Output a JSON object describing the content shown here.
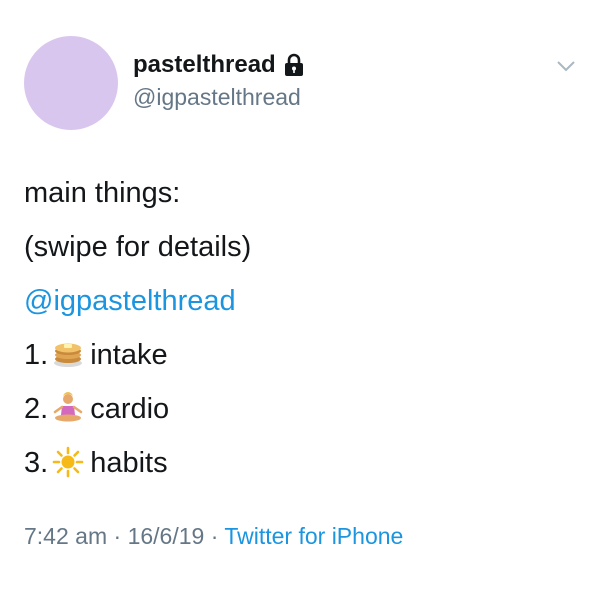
{
  "author": {
    "display_name": "pastelthread",
    "handle": "@igpastelthread",
    "avatar_color": "#d9c6ee",
    "protected_icon": "lock-icon"
  },
  "menu": {
    "icon": "chevron-down-icon"
  },
  "tweet": {
    "line1": "main things:",
    "line2": "(swipe for details)",
    "mention": "@igpastelthread",
    "items": [
      {
        "number": "1.",
        "emoji": "pancakes-icon",
        "label": "intake"
      },
      {
        "number": "2.",
        "emoji": "person-in-lotus-position-icon",
        "label": "cardio"
      },
      {
        "number": "3.",
        "emoji": "sun-icon",
        "label": "habits"
      }
    ]
  },
  "meta": {
    "time": "7:42 am",
    "separator1": " · ",
    "date": "16/6/19",
    "separator2": " · ",
    "source": "Twitter for iPhone"
  },
  "colors": {
    "link": "#1b95e0",
    "secondary_text": "#657786",
    "primary_text": "#14171a"
  }
}
